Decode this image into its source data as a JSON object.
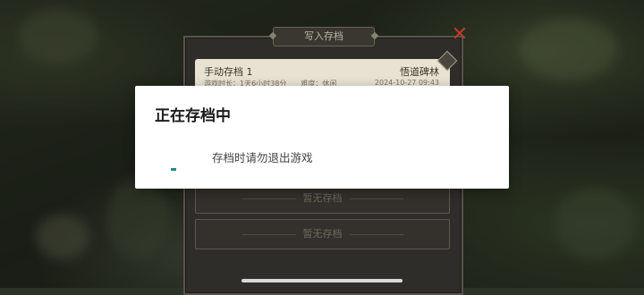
{
  "save_panel": {
    "title": "写入存档",
    "slots": [
      {
        "name": "手动存档 1",
        "location": "悟道碑林",
        "meta_visible_text": "游戏时长：1天6小时38分　　难度：休闲",
        "date_visible_text": "2024-10-27 09:43"
      },
      {
        "empty_label": "暂无存档"
      },
      {
        "empty_label": "暂无存档"
      }
    ]
  },
  "dialog": {
    "title": "正在存档中",
    "message": "存档时请勿退出游戏"
  },
  "colors": {
    "spinner": "#1e8c8c",
    "close": "#c0392b"
  }
}
